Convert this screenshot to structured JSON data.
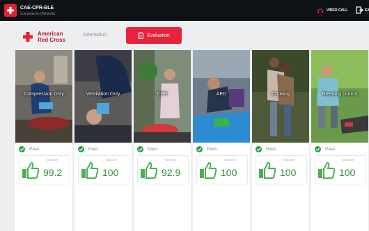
{
  "app": {
    "name": "CAE-CPR-BLE",
    "subtitle": "Connected to CPR40303",
    "video_call": "VIDEO CALL",
    "exit_label": "EX"
  },
  "brand": {
    "line1": "American",
    "line2": "Red Cross"
  },
  "tabs": {
    "orientation": "Orientation",
    "evaluation": "Evaluation"
  },
  "colors": {
    "accent": "#e8233a",
    "pass": "#2ea043",
    "score": "#2e8b34"
  },
  "cards": [
    {
      "title": "Compression Only",
      "status": "Pass",
      "score_label": "Total score",
      "score": "99.2"
    },
    {
      "title": "Ventilation Only",
      "status": "Pass",
      "score_label": "Total score",
      "score": "100"
    },
    {
      "title": "CPR",
      "status": "Pass",
      "score_label": "Total score",
      "score": "92.9"
    },
    {
      "title": "AED",
      "status": "Pass",
      "score_label": "Total score",
      "score": "100"
    },
    {
      "title": "Choking",
      "status": "Pass",
      "score_label": "Total score",
      "score": "100"
    },
    {
      "title": "Bleeding control",
      "status": "Pass",
      "score_label": "Total score",
      "score": "100"
    }
  ]
}
